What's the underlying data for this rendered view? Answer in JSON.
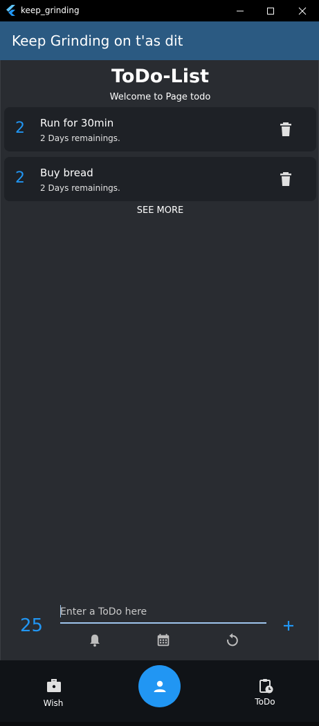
{
  "window": {
    "title": "keep_grinding"
  },
  "appbar": {
    "title": "Keep Grinding on t'as dit"
  },
  "page": {
    "heading": "ToDo-List",
    "subtitle": "Welcome to Page todo"
  },
  "todos": [
    {
      "count": "2",
      "title": "Run for 30min",
      "remaining": "2 Days remainings."
    },
    {
      "count": "2",
      "title": "Buy bread",
      "remaining": "2 Days remainings."
    }
  ],
  "see_more": "SEE MORE",
  "input": {
    "count": "25",
    "placeholder": "Enter a ToDo here",
    "value": ""
  },
  "nav": {
    "wish": "Wish",
    "todo": "ToDo"
  },
  "icons": {
    "app": "flutter-icon",
    "delete": "trash-icon",
    "add": "plus-icon",
    "notify": "bell-icon",
    "date": "calendar-icon",
    "repeat": "repeat-icon",
    "wish": "briefcase-icon",
    "profile": "person-icon",
    "todo": "clipboard-clock-icon"
  },
  "colors": {
    "accent": "#2196f3",
    "appbar": "#2b5a82",
    "background": "#292c31",
    "card": "#1e2126"
  }
}
